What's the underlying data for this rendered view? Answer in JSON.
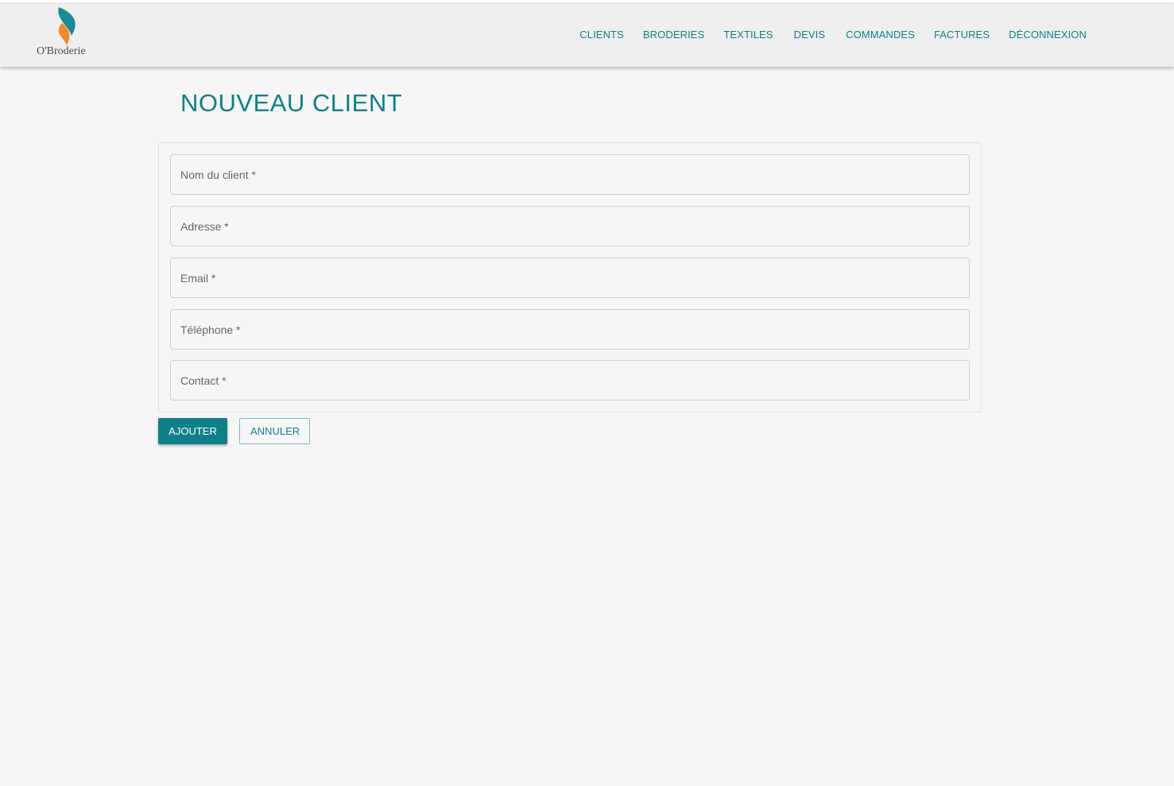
{
  "brand": {
    "name": "O'Broderie"
  },
  "nav": {
    "items": [
      {
        "label": "CLIENTS"
      },
      {
        "label": "BRODERIES"
      },
      {
        "label": "TEXTILES"
      },
      {
        "label": "DEVIS"
      },
      {
        "label": "COMMANDES"
      },
      {
        "label": "FACTURES"
      },
      {
        "label": "DÉCONNEXION"
      }
    ]
  },
  "page": {
    "title": "NOUVEAU CLIENT"
  },
  "form": {
    "fields": [
      {
        "placeholder": "Nom du client *",
        "value": ""
      },
      {
        "placeholder": "Adresse *",
        "value": ""
      },
      {
        "placeholder": "Email *",
        "value": ""
      },
      {
        "placeholder": "Téléphone *",
        "value": ""
      },
      {
        "placeholder": "Contact *",
        "value": ""
      }
    ],
    "submit_label": "AJOUTER",
    "cancel_label": "ANNULER"
  },
  "colors": {
    "accent": "#0f7f8a",
    "background": "#f6f6f6",
    "navbar": "#efefef",
    "logo_orange": "#f08a2c"
  },
  "icons": {
    "logo": "flame-leaf-logo-icon"
  }
}
